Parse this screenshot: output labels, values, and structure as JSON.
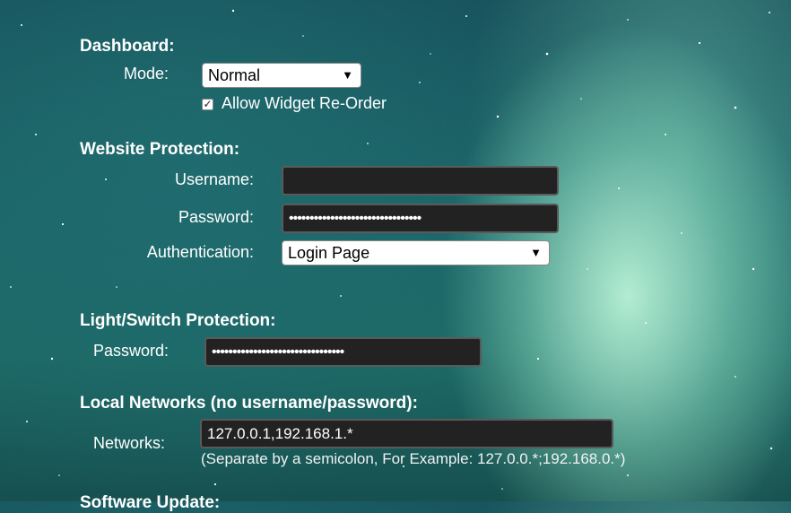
{
  "dashboard": {
    "heading": "Dashboard:",
    "mode_label": "Mode:",
    "mode_value": "Normal",
    "allow_reorder_label": "Allow Widget Re-Order",
    "allow_reorder_checked": true
  },
  "website_protection": {
    "heading": "Website Protection:",
    "username_label": "Username:",
    "username_value": "",
    "password_label": "Password:",
    "password_value": "••••••••••••••••••••••••••••••••",
    "auth_label": "Authentication:",
    "auth_value": "Login Page"
  },
  "light_switch_protection": {
    "heading": "Light/Switch Protection:",
    "password_label": "Password:",
    "password_value": "••••••••••••••••••••••••••••••••"
  },
  "local_networks": {
    "heading": "Local Networks (no username/password):",
    "networks_label": "Networks:",
    "networks_value": "127.0.0.1,192.168.1.*",
    "hint": "(Separate by a semicolon, For Example: 127.0.0.*;192.168.0.*)"
  },
  "software_update": {
    "heading": "Software Update:"
  },
  "icons": {
    "dropdown_arrow": "▼",
    "checkmark": "✓"
  }
}
